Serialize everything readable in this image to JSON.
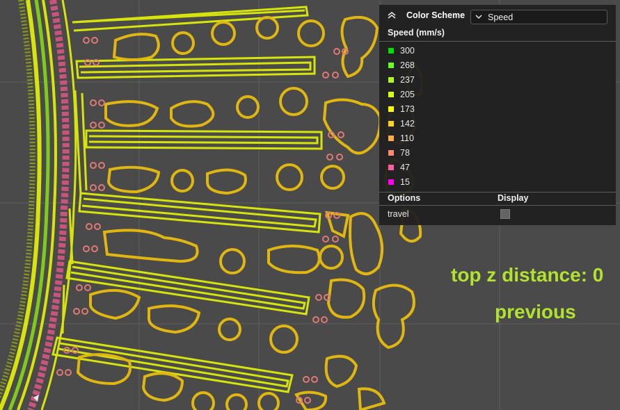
{
  "legend": {
    "color_scheme_label": "Color Scheme",
    "scheme_value": "Speed",
    "speed_title": "Speed (mm/s)",
    "items": [
      {
        "value": "300",
        "color": "#00e000"
      },
      {
        "value": "268",
        "color": "#6bfa23"
      },
      {
        "value": "237",
        "color": "#b0fa1a"
      },
      {
        "value": "205",
        "color": "#dcff18"
      },
      {
        "value": "173",
        "color": "#ffff00"
      },
      {
        "value": "142",
        "color": "#ffd22a"
      },
      {
        "value": "110",
        "color": "#ffae46"
      },
      {
        "value": "78",
        "color": "#ff8a72"
      },
      {
        "value": "47",
        "color": "#ff5ca3"
      },
      {
        "value": "15",
        "color": "#ff00f0"
      }
    ],
    "options_header": "Options",
    "display_header": "Display",
    "travel_label": "travel",
    "travel_checked": false
  },
  "overlay": {
    "top_z": "top z distance: 0",
    "previous": "previous"
  },
  "colors": {
    "background": "#4a4a4a",
    "fast_green": "#7ecb1a",
    "infill_yellow": "#d6e40c",
    "outline_yellow": "#e0b610",
    "perimeter_pink": "#c9557e",
    "overlay_text": "#b2e12f"
  }
}
